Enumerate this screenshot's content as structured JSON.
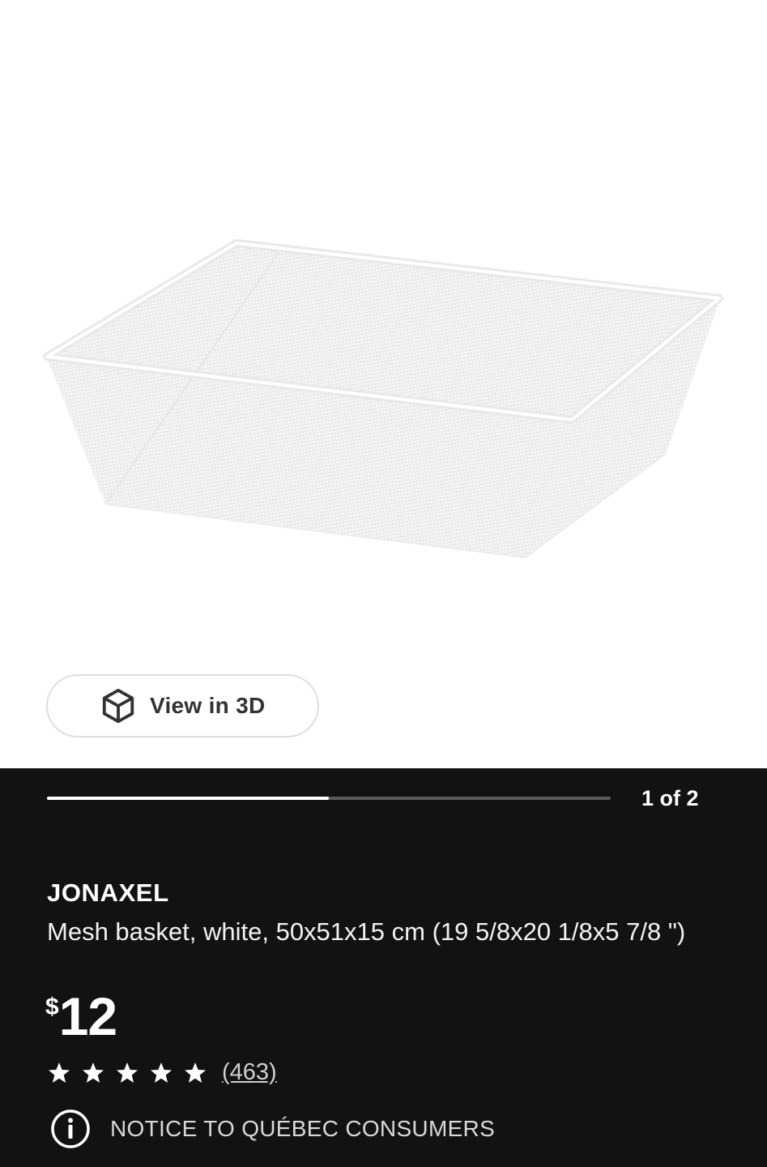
{
  "product": {
    "view3d_label": "View in 3D",
    "brand": "JONAXEL",
    "description": "Mesh basket, white, 50x51x15 cm (19 5/8x20 1/8x5 7/8 \")",
    "price_currency": "$",
    "price_amount": "12",
    "rating_stars": 5,
    "review_count": "(463)"
  },
  "gallery": {
    "pager_text": "1 of 2",
    "progress_fraction": 0.5
  },
  "notice": {
    "text": "NOTICE TO QUÉBEC CONSUMERS"
  },
  "colors": {
    "panel_bg": "#121212",
    "progress_fill": "#ffffff",
    "progress_track": "#5a5a5a"
  },
  "icons": [
    "cube-3d-icon",
    "star-icon",
    "info-icon"
  ]
}
